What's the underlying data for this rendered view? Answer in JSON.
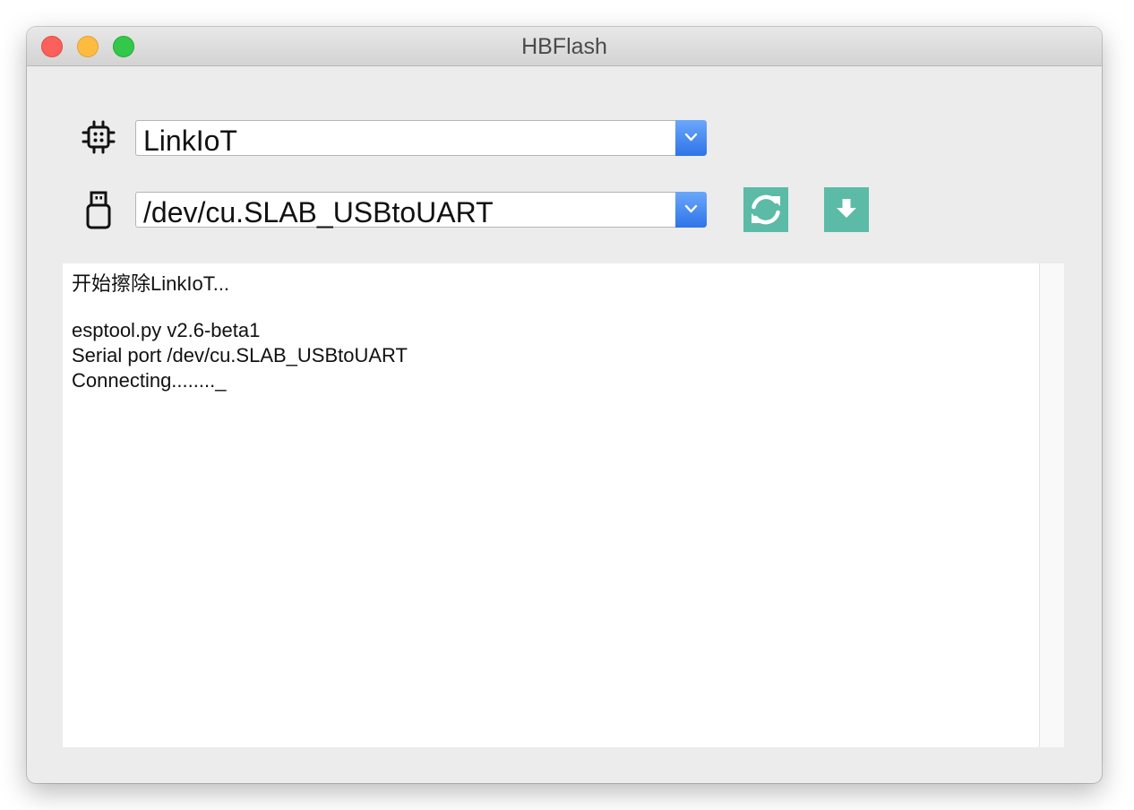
{
  "window": {
    "title": "HBFlash"
  },
  "device_row": {
    "icon": "chip-icon",
    "selected": "LinkIoT"
  },
  "port_row": {
    "icon": "usb-drive-icon",
    "selected": "/dev/cu.SLAB_USBtoUART"
  },
  "actions": {
    "refresh_icon": "refresh-icon",
    "download_icon": "download-arrow-icon",
    "accent_color": "#5bbba7"
  },
  "log": {
    "lines": [
      "开始擦除LinkIoT...",
      "",
      "esptool.py v2.6-beta1",
      "Serial port /dev/cu.SLAB_USBtoUART",
      "Connecting........_"
    ]
  }
}
